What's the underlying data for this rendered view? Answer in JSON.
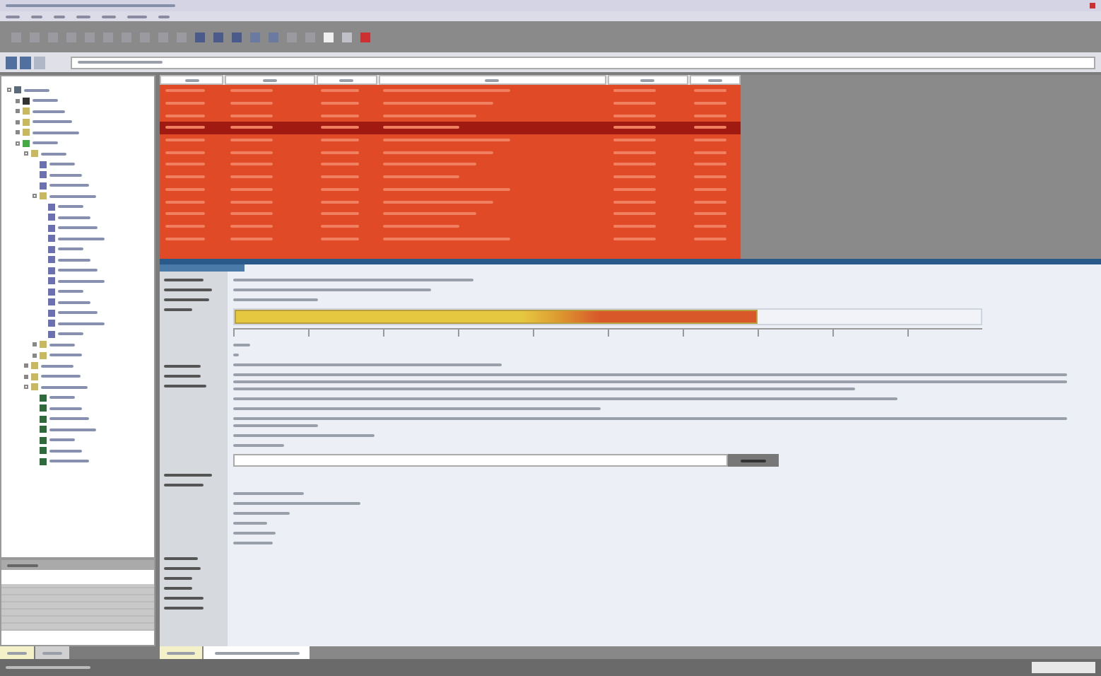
{
  "tree": [
    {
      "kind": "root",
      "expanded": true,
      "children": [
        {
          "kind": "computer",
          "expanded": false
        },
        {
          "kind": "folder",
          "expanded": false
        },
        {
          "kind": "folder",
          "expanded": false
        },
        {
          "kind": "folder",
          "expanded": false
        },
        {
          "kind": "site",
          "expanded": true,
          "children": [
            {
              "kind": "folder",
              "expanded": true,
              "children": [
                {
                  "kind": "page"
                },
                {
                  "kind": "page"
                },
                {
                  "kind": "page"
                },
                {
                  "kind": "folder",
                  "expanded": true,
                  "children": [
                    {
                      "kind": "page"
                    },
                    {
                      "kind": "page"
                    },
                    {
                      "kind": "page"
                    },
                    {
                      "kind": "page"
                    },
                    {
                      "kind": "page"
                    },
                    {
                      "kind": "page"
                    },
                    {
                      "kind": "page"
                    },
                    {
                      "kind": "page"
                    },
                    {
                      "kind": "page"
                    },
                    {
                      "kind": "page"
                    },
                    {
                      "kind": "page"
                    },
                    {
                      "kind": "page"
                    },
                    {
                      "kind": "page"
                    }
                  ]
                },
                {
                  "kind": "folder",
                  "expanded": false
                },
                {
                  "kind": "folder",
                  "expanded": false
                }
              ]
            },
            {
              "kind": "folder",
              "expanded": false
            },
            {
              "kind": "folder",
              "expanded": false
            },
            {
              "kind": "folder",
              "expanded": true,
              "children": [
                {
                  "kind": "module"
                },
                {
                  "kind": "module"
                },
                {
                  "kind": "module"
                },
                {
                  "kind": "module"
                },
                {
                  "kind": "module"
                },
                {
                  "kind": "module"
                },
                {
                  "kind": "module"
                }
              ]
            }
          ]
        }
      ]
    }
  ],
  "table_rows": [
    {
      "selected": false
    },
    {
      "selected": false
    },
    {
      "selected": false
    },
    {
      "selected": true
    },
    {
      "selected": false
    },
    {
      "selected": false
    },
    {
      "selected": false
    },
    {
      "selected": false
    },
    {
      "selected": false
    },
    {
      "selected": false
    },
    {
      "selected": false
    },
    {
      "selected": false
    },
    {
      "selected": false
    }
  ],
  "risk_score": {
    "level": 0.7
  },
  "bottom_tabs": [
    {
      "selected": true
    },
    {
      "selected": false
    }
  ],
  "left_tabs": [
    {
      "selected": true
    },
    {
      "selected": false
    }
  ]
}
